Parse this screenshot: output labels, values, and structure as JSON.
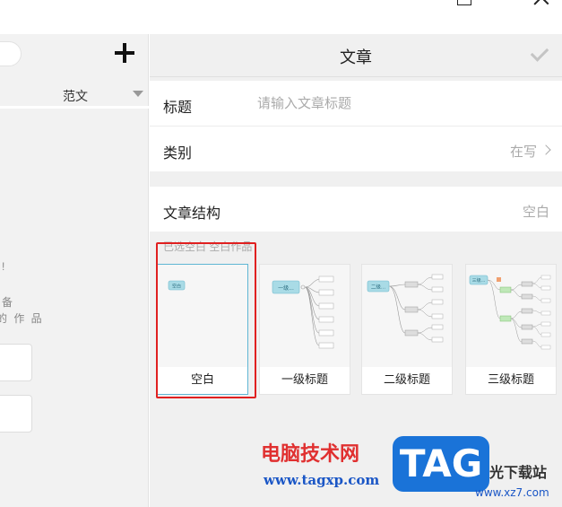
{
  "left_panel": {
    "filter_label": "范文",
    "hint_line1": "!",
    "hint_line2": "备",
    "hint_line3": "的 作 品"
  },
  "header": {
    "title": "文章"
  },
  "form": {
    "title_label": "标题",
    "title_placeholder": "请输入文章标题",
    "title_value": "",
    "category_label": "类别",
    "category_value": "在写",
    "structure_label": "文章结构",
    "structure_value": "空白"
  },
  "templates": {
    "section_label": "已选空白 空白作品",
    "items": [
      {
        "label": "空白",
        "selected": true,
        "root_text": "空白"
      },
      {
        "label": "一级标题",
        "selected": false,
        "root_text": "一级..."
      },
      {
        "label": "二级标题",
        "selected": false,
        "root_text": "二级..."
      },
      {
        "label": "三级标题",
        "selected": false,
        "root_text": "三级..."
      }
    ]
  },
  "watermark": {
    "site_name": "电脑技术网",
    "site_url": "www.tagxp.com",
    "logo_text": "TAG",
    "side_text": "光下载站",
    "side_url": "www.xz7.com"
  },
  "colors": {
    "accent": "#5fb6d4",
    "highlight": "#e02020",
    "background": "#f0f0f0"
  },
  "icons": {
    "add": "plus-icon",
    "confirm": "check-icon",
    "dropdown": "triangle-down-icon",
    "chevron": "chevron-right-icon"
  }
}
